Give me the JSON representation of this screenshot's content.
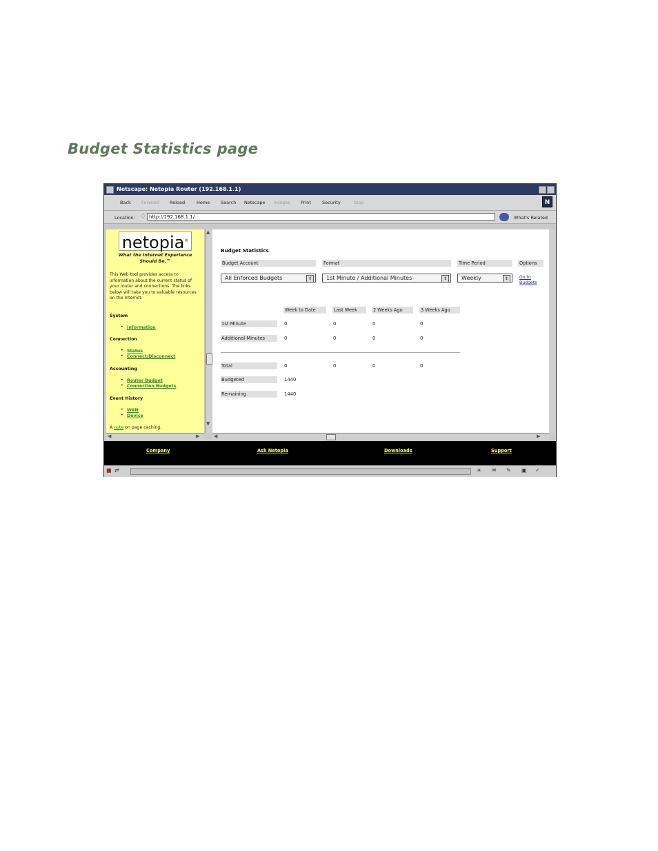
{
  "heading": "Budget Statistics page",
  "browser": {
    "title": "Netscape: Netopia Router (192.168.1.1)",
    "toolbar": {
      "back": "Back",
      "forward": "Forward",
      "reload": "Reload",
      "home": "Home",
      "search": "Search",
      "netscape": "Netscape",
      "images": "Images",
      "print": "Print",
      "security": "Security",
      "stop": "Stop",
      "logo": "N"
    },
    "location_label": "Location:",
    "url": "http://192.168.1.1/",
    "whats_related": "What's Related"
  },
  "sidebar": {
    "logo": "netopia",
    "logo_mark": "®",
    "tagline": "What the Internet Experience Should Be.™",
    "intro": "This Web tool provides access to information about the current status of your router and connections. The links below will take you to valuable resources on the Internet.",
    "sections": [
      {
        "title": "System",
        "links": [
          "Information"
        ]
      },
      {
        "title": "Connection",
        "links": [
          "Status",
          "Connect/Disconnect"
        ]
      },
      {
        "title": "Accounting",
        "links": [
          "Router Budget",
          "Connection Budgets"
        ]
      },
      {
        "title": "Event History",
        "links": [
          "WAN",
          "Device"
        ]
      }
    ],
    "note": {
      "pre": "A ",
      "link": "note",
      "post": " on page caching."
    }
  },
  "main": {
    "title": "Budget Statistics",
    "headers": {
      "account": "Budget Account",
      "format": "Format",
      "period": "Time Period",
      "options": "Options"
    },
    "selects": {
      "account": "All Enforced Budgets",
      "format": "1st Minute / Additional Minutes",
      "period": "Weekly"
    },
    "go_link": "Go to Budgets",
    "columns": [
      "Week to Date",
      "Last Week",
      "2 Weeks Ago",
      "3 Weeks Ago"
    ],
    "rows": [
      {
        "label": "1st Minute",
        "values": [
          "0",
          "0",
          "0",
          "0"
        ]
      },
      {
        "label": "Additional Minutes",
        "values": [
          "0",
          "0",
          "0",
          "0"
        ]
      }
    ],
    "total": {
      "label": "Total",
      "values": [
        "0",
        "0",
        "0",
        "0"
      ]
    },
    "budgeted": {
      "label": "Budgeted",
      "value": "1440"
    },
    "remaining": {
      "label": "Remaining",
      "value": "1440"
    }
  },
  "footer": {
    "links": [
      "Company",
      "Ask Netopia",
      "Downloads",
      "Support"
    ]
  },
  "colors": {
    "heading": "#5d7a58",
    "sidebar_bg": "#ffff99",
    "titlebar": "#2c3b66",
    "footer_link": "#ffff66"
  }
}
